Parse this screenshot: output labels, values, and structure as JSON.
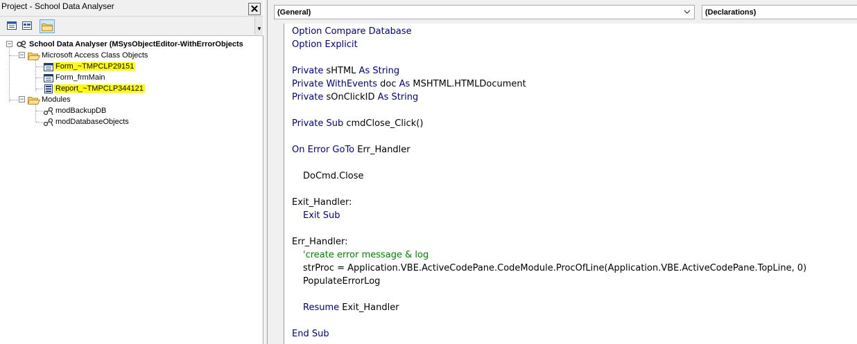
{
  "project_pane": {
    "title": "Project - School Data Analyser",
    "close_glyph": "✕",
    "toolbar": {
      "view_object": "view-object-icon",
      "view_code": "view-code-icon",
      "toggle_folders": "folder-icon"
    },
    "tree": {
      "root": {
        "label": "School Data Analyser (MSysObjectEditor-WithErrorObjects",
        "icon": "vba-project-icon",
        "expander": "⊟"
      },
      "class_folder": {
        "label": "Microsoft Access Class Objects",
        "icon": "folder-icon",
        "expander": "⊟"
      },
      "class_items": [
        {
          "label": "Form_~TMPCLP29151",
          "icon": "form-icon",
          "highlighted": true
        },
        {
          "label": "Form_frmMain",
          "icon": "form-icon",
          "highlighted": false
        },
        {
          "label": "Report_~TMPCLP344121",
          "icon": "report-icon",
          "highlighted": true
        }
      ],
      "modules_folder": {
        "label": "Modules",
        "icon": "folder-icon",
        "expander": "⊟"
      },
      "module_items": [
        {
          "label": "modBackupDB",
          "icon": "module-icon"
        },
        {
          "label": "modDatabaseObjects",
          "icon": "module-icon"
        }
      ]
    }
  },
  "code_window": {
    "object_combo": "(General)",
    "procedure_combo": "(Declarations)",
    "lines": [
      {
        "segments": [
          {
            "t": "Option Compare Database",
            "c": "kw"
          }
        ]
      },
      {
        "segments": [
          {
            "t": "Option Explicit",
            "c": "kw"
          }
        ]
      },
      {
        "segments": []
      },
      {
        "segments": [
          {
            "t": "Private",
            "c": "kw"
          },
          {
            "t": " sHTML ",
            "c": ""
          },
          {
            "t": "As String",
            "c": "kw"
          }
        ]
      },
      {
        "segments": [
          {
            "t": "Private WithEvents",
            "c": "kw"
          },
          {
            "t": " doc ",
            "c": ""
          },
          {
            "t": "As",
            "c": "kw"
          },
          {
            "t": " MSHTML.HTMLDocument",
            "c": ""
          }
        ]
      },
      {
        "segments": [
          {
            "t": "Private",
            "c": "kw"
          },
          {
            "t": " sOnClickID ",
            "c": ""
          },
          {
            "t": "As String",
            "c": "kw"
          }
        ]
      },
      {
        "segments": []
      },
      {
        "segments": [
          {
            "t": "Private Sub",
            "c": "kw"
          },
          {
            "t": " cmdClose_Click()",
            "c": ""
          }
        ]
      },
      {
        "segments": []
      },
      {
        "segments": [
          {
            "t": "On Error GoTo",
            "c": "kw"
          },
          {
            "t": " Err_Handler",
            "c": ""
          }
        ]
      },
      {
        "segments": []
      },
      {
        "indent": true,
        "segments": [
          {
            "t": "DoCmd.Close",
            "c": ""
          }
        ]
      },
      {
        "segments": []
      },
      {
        "segments": [
          {
            "t": "Exit_Handler:",
            "c": ""
          }
        ]
      },
      {
        "indent": true,
        "segments": [
          {
            "t": "Exit Sub",
            "c": "kw"
          }
        ]
      },
      {
        "segments": []
      },
      {
        "segments": [
          {
            "t": "Err_Handler:",
            "c": ""
          }
        ]
      },
      {
        "indent": true,
        "segments": [
          {
            "t": "'create error message & log",
            "c": "cm"
          }
        ]
      },
      {
        "indent": true,
        "segments": [
          {
            "t": "strProc = Application.VBE.ActiveCodePane.CodeModule.ProcOfLine(Application.VBE.ActiveCodePane.TopLine, 0)",
            "c": ""
          }
        ]
      },
      {
        "indent": true,
        "segments": [
          {
            "t": "PopulateErrorLog",
            "c": ""
          }
        ]
      },
      {
        "segments": []
      },
      {
        "indent": true,
        "segments": [
          {
            "t": "Resume",
            "c": "kw"
          },
          {
            "t": " Exit_Handler",
            "c": ""
          }
        ]
      },
      {
        "segments": []
      },
      {
        "segments": [
          {
            "t": "End Sub",
            "c": "kw"
          }
        ]
      }
    ]
  },
  "colors": {
    "keyword": "#000080",
    "comment": "#008000",
    "highlight": "#ffff00",
    "chrome": "#f0f0f0"
  }
}
